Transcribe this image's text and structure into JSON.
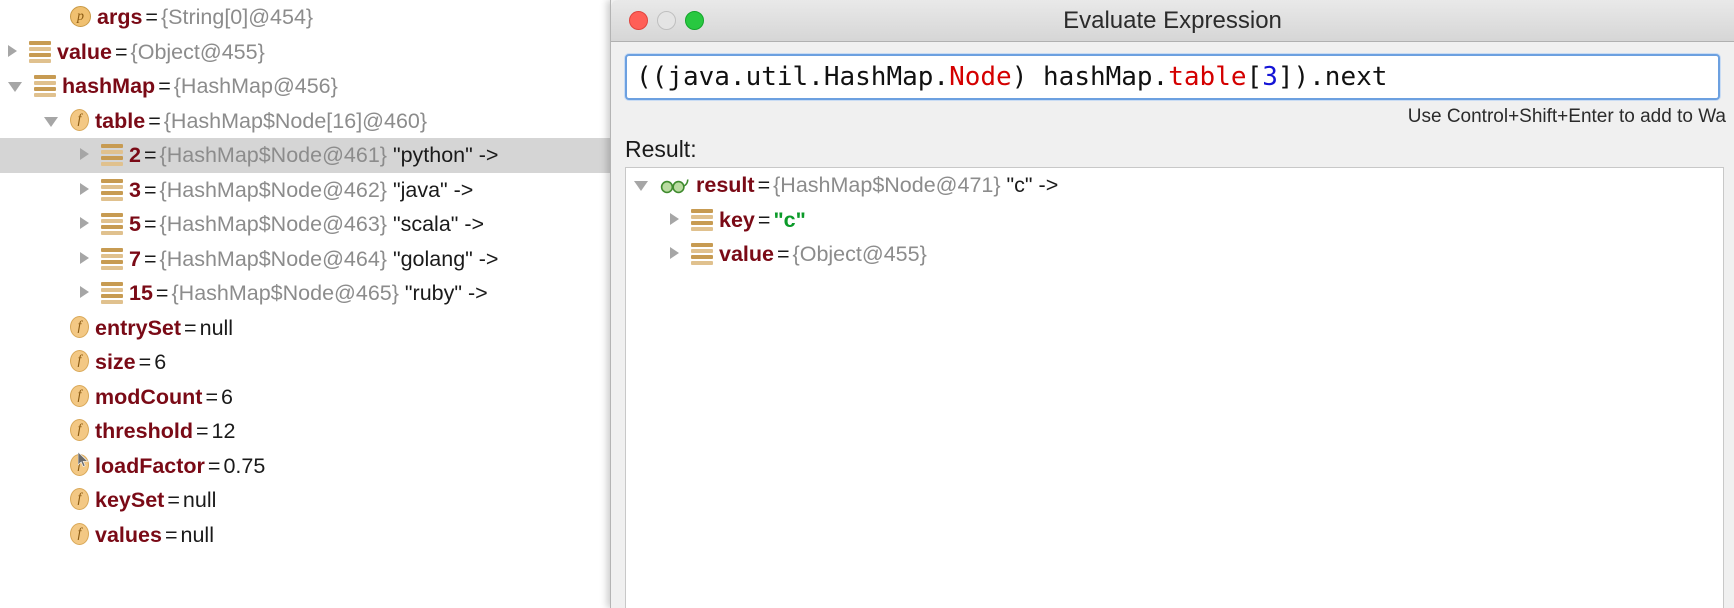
{
  "variables_panel": {
    "name": "debugger-variables-tree",
    "rows": [
      {
        "indent": 1,
        "twisty": "none",
        "icon": "parameter-icon",
        "name": "args",
        "eq": "=",
        "value": "{String[0]@454}",
        "value_kind": "ref",
        "suffix": "",
        "selected": false
      },
      {
        "indent": 0,
        "twisty": "closed",
        "icon": "object-icon",
        "name": "value",
        "eq": "=",
        "value": "{Object@455}",
        "value_kind": "ref",
        "suffix": "",
        "selected": false
      },
      {
        "indent": 0,
        "twisty": "open",
        "icon": "object-icon",
        "name": "hashMap",
        "eq": "=",
        "value": "{HashMap@456}",
        "value_kind": "ref",
        "suffix": "",
        "selected": false
      },
      {
        "indent": 1,
        "twisty": "open",
        "icon": "field-icon",
        "name": "table",
        "eq": "=",
        "value": "{HashMap$Node[16]@460}",
        "value_kind": "ref",
        "suffix": "",
        "selected": false
      },
      {
        "indent": 2,
        "twisty": "closed",
        "icon": "object-icon",
        "name": "2",
        "eq": "=",
        "value": "{HashMap$Node@461}",
        "value_kind": "ref",
        "suffix": "\"python\" ->",
        "selected": true
      },
      {
        "indent": 2,
        "twisty": "closed",
        "icon": "object-icon",
        "name": "3",
        "eq": "=",
        "value": "{HashMap$Node@462}",
        "value_kind": "ref",
        "suffix": "\"java\" ->",
        "selected": false
      },
      {
        "indent": 2,
        "twisty": "closed",
        "icon": "object-icon",
        "name": "5",
        "eq": "=",
        "value": "{HashMap$Node@463}",
        "value_kind": "ref",
        "suffix": "\"scala\" ->",
        "selected": false
      },
      {
        "indent": 2,
        "twisty": "closed",
        "icon": "object-icon",
        "name": "7",
        "eq": "=",
        "value": "{HashMap$Node@464}",
        "value_kind": "ref",
        "suffix": "\"golang\" ->",
        "selected": false
      },
      {
        "indent": 2,
        "twisty": "closed",
        "icon": "object-icon",
        "name": "15",
        "eq": "=",
        "value": "{HashMap$Node@465}",
        "value_kind": "ref",
        "suffix": "\"ruby\" ->",
        "selected": false
      },
      {
        "indent": 1,
        "twisty": "none",
        "icon": "field-icon",
        "name": "entrySet",
        "eq": "=",
        "value": "null",
        "value_kind": "plain",
        "suffix": "",
        "selected": false
      },
      {
        "indent": 1,
        "twisty": "none",
        "icon": "field-icon",
        "name": "size",
        "eq": "=",
        "value": "6",
        "value_kind": "plain",
        "suffix": "",
        "selected": false
      },
      {
        "indent": 1,
        "twisty": "none",
        "icon": "field-icon",
        "name": "modCount",
        "eq": "=",
        "value": "6",
        "value_kind": "plain",
        "suffix": "",
        "selected": false
      },
      {
        "indent": 1,
        "twisty": "none",
        "icon": "field-icon",
        "name": "threshold",
        "eq": "=",
        "value": "12",
        "value_kind": "plain",
        "suffix": "",
        "selected": false
      },
      {
        "indent": 1,
        "twisty": "none",
        "icon": "field-icon",
        "name": "loadFactor",
        "eq": "=",
        "value": "0.75",
        "value_kind": "plain",
        "suffix": "",
        "selected": false
      },
      {
        "indent": 1,
        "twisty": "none",
        "icon": "field-icon",
        "name": "keySet",
        "eq": "=",
        "value": "null",
        "value_kind": "plain",
        "suffix": "",
        "selected": false
      },
      {
        "indent": 1,
        "twisty": "none",
        "icon": "field-icon",
        "name": "values",
        "eq": "=",
        "value": "null",
        "value_kind": "plain",
        "suffix": "",
        "selected": false
      }
    ]
  },
  "dialog": {
    "title": "Evaluate Expression",
    "window_controls": {
      "close_label": "close",
      "minimize_label": "minimize",
      "zoom_label": "zoom"
    },
    "expression": {
      "value": "((java.util.HashMap.Node) hashMap.table[3]).next",
      "tokens": [
        {
          "text": "((java.util.HashMap.",
          "kind": "plain"
        },
        {
          "text": "Node",
          "kind": "type"
        },
        {
          "text": ") hashMap.",
          "kind": "plain"
        },
        {
          "text": "table",
          "kind": "type"
        },
        {
          "text": "[",
          "kind": "plain"
        },
        {
          "text": "3",
          "kind": "number"
        },
        {
          "text": "]).next",
          "kind": "plain"
        }
      ]
    },
    "hint": "Use Control+Shift+Enter to add to Wa",
    "result_label": "Result:",
    "result_rows": [
      {
        "indent": 0,
        "twisty": "open",
        "icon": "watch-glasses-icon",
        "name": "result",
        "eq": "=",
        "value": "{HashMap$Node@471}",
        "value_kind": "ref",
        "suffix": "\"c\" ->",
        "selected": false
      },
      {
        "indent": 1,
        "twisty": "closed",
        "icon": "object-icon",
        "name": "key",
        "eq": "=",
        "value": "\"c\"",
        "value_kind": "string",
        "suffix": "",
        "selected": false
      },
      {
        "indent": 1,
        "twisty": "closed",
        "icon": "object-icon",
        "name": "value",
        "eq": "=",
        "value": "{Object@455}",
        "value_kind": "ref",
        "suffix": "",
        "selected": false
      }
    ]
  },
  "colors": {
    "selection": "#d5d5d5",
    "name": "#7a0a16",
    "reference": "#8c8c8c",
    "string_green": "#0b9a29",
    "syntax_type": "#d40000",
    "syntax_number": "#1414d6",
    "focus_ring": "#6ca0e0",
    "traffic_close": "#ff5f57",
    "traffic_minimize": "#e4e4e4",
    "traffic_zoom": "#28c840"
  }
}
